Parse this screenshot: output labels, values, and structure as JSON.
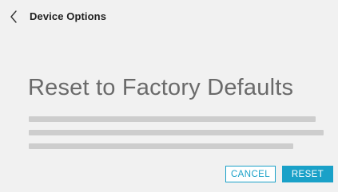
{
  "header": {
    "back_icon": "chevron-left-icon",
    "title": "Device Options"
  },
  "main": {
    "title": "Reset to Factory Defaults"
  },
  "actions": {
    "cancel_label": "CANCEL",
    "reset_label": "RESET"
  },
  "colors": {
    "background": "#f1f1f1",
    "accent": "#1aa1c8",
    "title_text": "#6a6a6a",
    "placeholder_line": "#cdcdcd"
  }
}
